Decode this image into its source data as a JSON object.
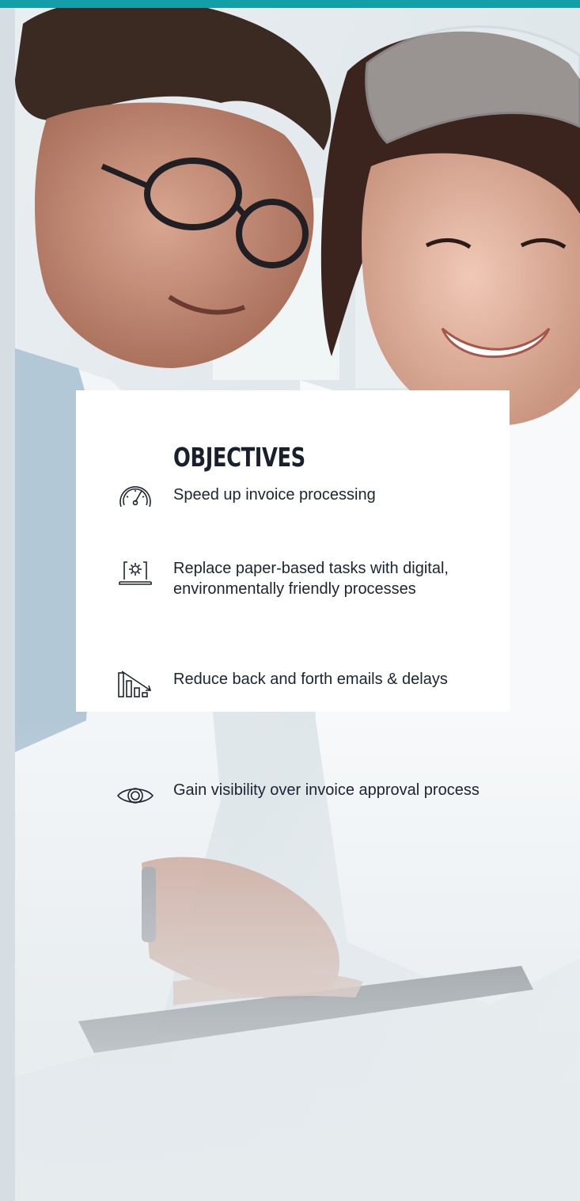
{
  "objectives": {
    "title": "Objectives",
    "items": [
      {
        "icon": "speedometer-icon",
        "text": "Speed up invoice processing"
      },
      {
        "icon": "laptop-gear-icon",
        "text": "Replace paper-based tasks with digital, environmentally friendly processes"
      },
      {
        "icon": "decreasing-bars-icon",
        "text": "Reduce back and forth emails & delays"
      },
      {
        "icon": "eye-icon",
        "text": "Gain visibility over invoice approval process"
      }
    ]
  },
  "colors": {
    "accent_bar": "#139ea8",
    "card_bg": "#ffffff",
    "title_text": "#1a1f2e",
    "body_text": "#1d2431"
  }
}
